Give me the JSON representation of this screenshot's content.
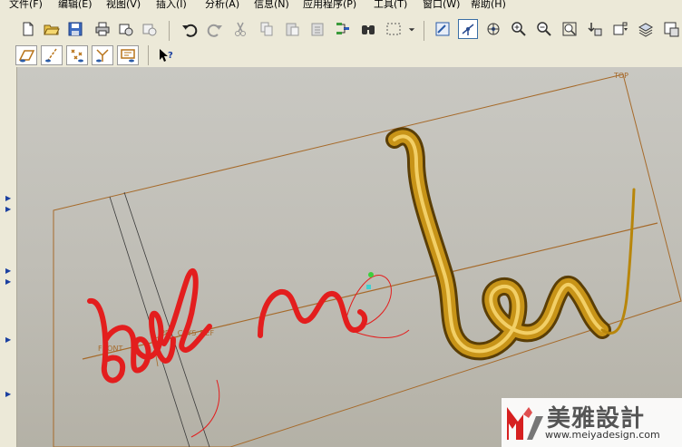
{
  "menu": {
    "items": [
      {
        "label": "文件(F)"
      },
      {
        "label": "编辑(E)"
      },
      {
        "label": "视图(V)"
      },
      {
        "label": "插入(I)"
      },
      {
        "label": "分析(A)"
      },
      {
        "label": "信息(N)"
      },
      {
        "label": "应用程序(P)"
      },
      {
        "label": "工具(T)"
      },
      {
        "label": "窗口(W)"
      },
      {
        "label": "帮助(H)"
      }
    ]
  },
  "toolbar": {
    "main_icons": [
      "new-file-icon",
      "open-folder-icon",
      "save-icon",
      "print-icon",
      "send-mail-icon",
      "mail-icon",
      "undo-icon",
      "redo-icon",
      "cut-icon",
      "copy-icon",
      "paste-icon",
      "paste-special-icon",
      "regenerate-icon",
      "find-icon",
      "select-box-icon",
      "dropdown-icon",
      "repaint-icon",
      "spin-center-icon",
      "orient-icon",
      "zoom-in-icon",
      "zoom-out-icon",
      "refit-icon",
      "view-manager-icon",
      "saved-views-icon",
      "layers-icon",
      "window-icon"
    ],
    "datum_icons": [
      "datum-plane-display-icon",
      "datum-axis-display-icon",
      "datum-point-display-icon",
      "coordinate-system-display-icon",
      "annotation-display-icon",
      "context-help-icon"
    ]
  },
  "viewport": {
    "labels": {
      "top": "TOP",
      "front": "FRONT",
      "csys": "PRT_CSYS_DEF"
    },
    "colors": {
      "red_curve": "#e31e1e",
      "gold_tube": "#b8860b",
      "datum": "#a66a2a"
    }
  },
  "watermark": {
    "brand": "美雅設計",
    "url": "www.meiyadesign.com"
  }
}
